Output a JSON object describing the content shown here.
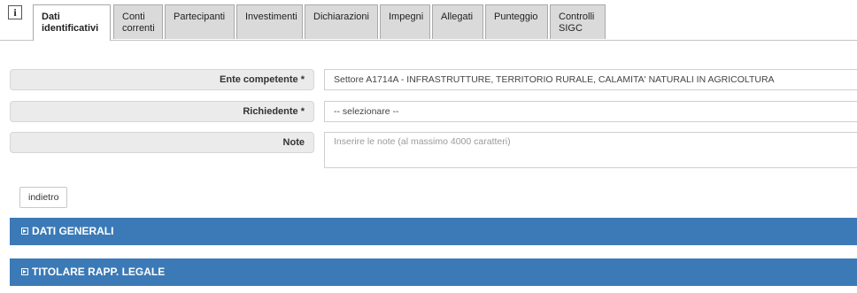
{
  "info_icon": "i",
  "tabs": [
    {
      "label": "Dati\nidentificativi",
      "active": true
    },
    {
      "label": "Conti\ncorrenti",
      "active": false
    },
    {
      "label": "Partecipanti",
      "active": false
    },
    {
      "label": "Investimenti",
      "active": false
    },
    {
      "label": "Dichiarazioni",
      "active": false
    },
    {
      "label": "Impegni",
      "active": false
    },
    {
      "label": "Allegati",
      "active": false
    },
    {
      "label": "Punteggio",
      "active": false
    },
    {
      "label": "Controlli\nSIGC",
      "active": false
    }
  ],
  "form": {
    "ente": {
      "label": "Ente competente *",
      "value": "Settore A1714A - INFRASTRUTTURE, TERRITORIO RURALE, CALAMITA' NATURALI IN AGRICOLTURA"
    },
    "richiedente": {
      "label": "Richiedente *",
      "value": "-- selezionare --"
    },
    "note": {
      "label": "Note",
      "placeholder": "Inserire le note (al massimo 4000 caratteri)"
    }
  },
  "back_button": "indietro",
  "sections": [
    {
      "label": "DATI GENERALI"
    },
    {
      "label": "TITOLARE RAPP. LEGALE"
    }
  ],
  "colors": {
    "section_bar": "#3b7ab7",
    "tab_inactive": "#dadada",
    "label_bg": "#ebebeb"
  }
}
